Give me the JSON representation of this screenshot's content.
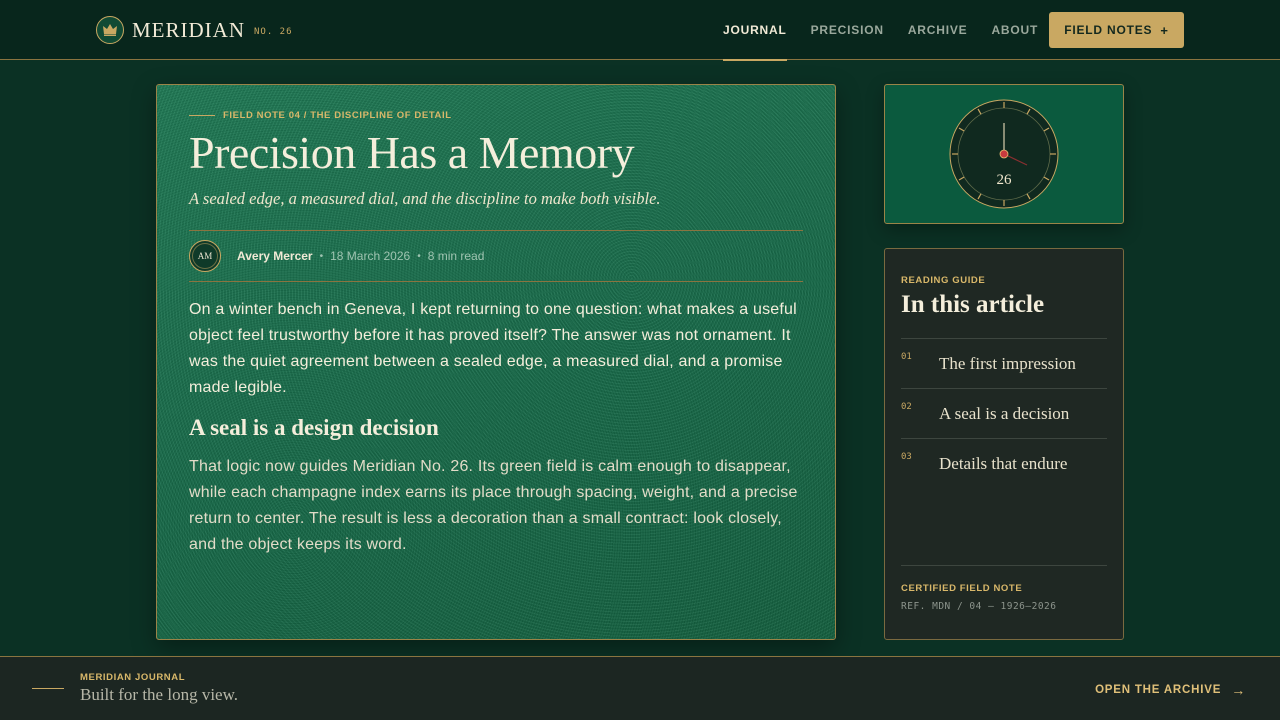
{
  "header": {
    "brand_name": "MERIDIAN",
    "issue": "NO. 26",
    "logo_icon": "crown-icon",
    "nav": [
      {
        "label": "JOURNAL",
        "active": true
      },
      {
        "label": "PRECISION",
        "active": false
      },
      {
        "label": "ARCHIVE",
        "active": false
      },
      {
        "label": "ABOUT",
        "active": false
      }
    ],
    "cta_label": "FIELD NOTES",
    "cta_icon": "+"
  },
  "article": {
    "eyebrow": "FIELD NOTE 04 / THE DISCIPLINE OF DETAIL",
    "title": "Precision Has a Memory",
    "dek": "A sealed edge, a measured dial, and the discipline to make both visible.",
    "author_initials": "AM",
    "author": "Avery Mercer",
    "date": "18 March 2026",
    "read_time": "8 min read",
    "separator": "•",
    "paragraph_1": "On a winter bench in Geneva, I kept returning to one question: what makes a useful object feel trustworthy before it has proved itself? The answer was not ornament. It was the quiet agreement between a sealed edge, a measured dial, and a promise made legible.",
    "subhead": "A seal is a design decision",
    "paragraph_2": "That logic now guides Meridian No. 26. Its green field is calm enough to disappear, while each champagne index earns its place through spacing, weight, and a precise return to center. The result is less a decoration than a small contract: look closely, and the object keeps its word."
  },
  "dial": {
    "number": "26",
    "icon": "watch-dial-icon"
  },
  "guide": {
    "eyebrow": "READING GUIDE",
    "title": "In this article",
    "items": [
      {
        "num": "01",
        "label": "The first impression"
      },
      {
        "num": "02",
        "label": "A seal is a decision"
      },
      {
        "num": "03",
        "label": "Details that endure"
      }
    ],
    "cert_label": "CERTIFIED FIELD NOTE",
    "ref": "REF. MDN / 04 — 1926–2026"
  },
  "footer": {
    "eyebrow": "MERIDIAN JOURNAL",
    "tagline": "Built for the long view.",
    "link_label": "OPEN THE ARCHIVE",
    "link_icon": "→"
  },
  "colors": {
    "background": "#0b3124",
    "header": "#08261c",
    "card_green": "#1f7a55",
    "champagne": "#c9a862",
    "dark_panel": "#1f2823",
    "hand_red": "#b8323a"
  }
}
